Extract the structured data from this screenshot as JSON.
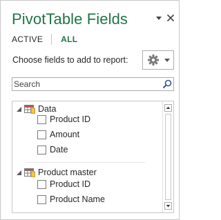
{
  "header": {
    "title": "PivotTable Fields",
    "dropdown_icon": "triangle-down-icon",
    "close_icon": "close-icon"
  },
  "tabs": [
    {
      "label": "ACTIVE"
    },
    {
      "label": "ALL"
    }
  ],
  "prompt": "Choose fields to add to report:",
  "settings_button": {
    "icon": "gear-icon",
    "secondary_icon": "chevron-down-icon"
  },
  "search": {
    "placeholder": "Search",
    "value": "",
    "icon": "search-icon"
  },
  "tables": [
    {
      "name": "Data",
      "fields": [
        {
          "label": "Product ID",
          "checked": false
        },
        {
          "label": "Amount",
          "checked": false
        },
        {
          "label": "Date",
          "checked": false
        }
      ]
    },
    {
      "name": "Product master",
      "fields": [
        {
          "label": "Product ID",
          "checked": false
        },
        {
          "label": "Product Name",
          "checked": false
        }
      ]
    }
  ],
  "colors": {
    "accent": "#217346",
    "text": "#262626",
    "border": "#c6c6c6"
  }
}
